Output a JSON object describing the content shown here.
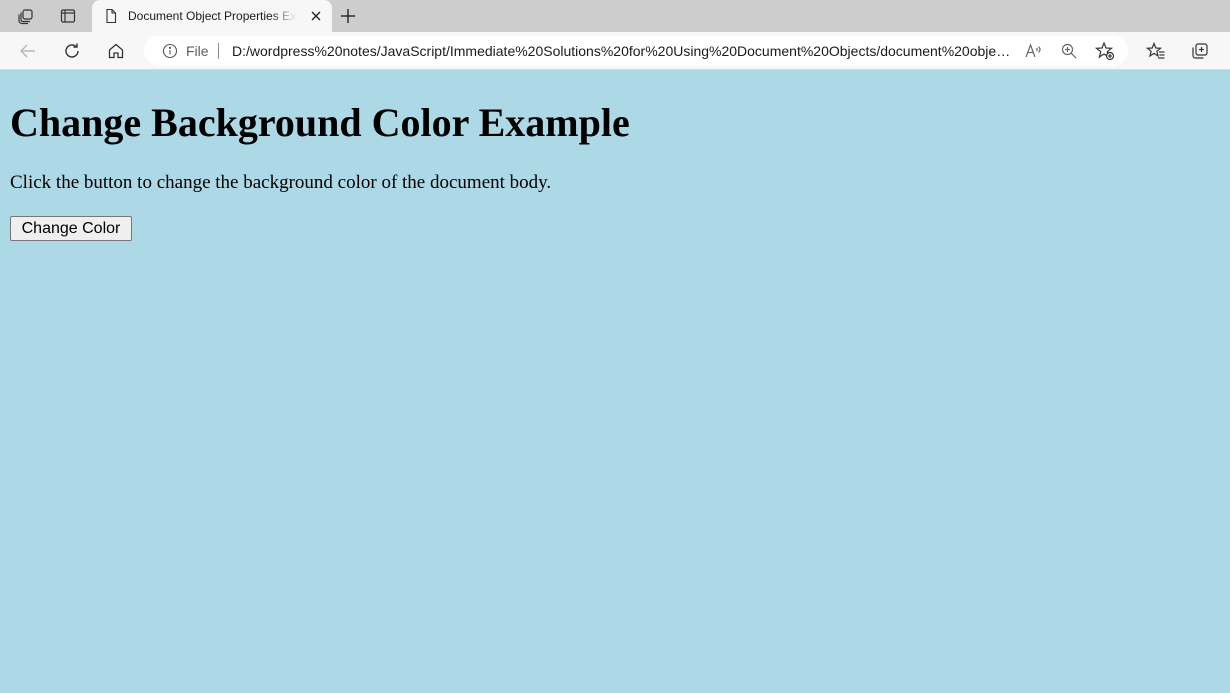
{
  "browser": {
    "tab": {
      "title": "Document Object Properties Example"
    },
    "address_bar": {
      "scheme_label": "File",
      "url": "D:/wordpress%20notes/JavaScript/Immediate%20Solutions%20for%20Using%20Document%20Objects/document%20object..."
    },
    "icons": {
      "workspaces": "workspaces-icon",
      "vertical_tabs": "vertical-tabs-icon",
      "page": "page-icon",
      "close": "close-icon",
      "new_tab": "plus-icon",
      "back": "back-arrow-icon",
      "refresh": "refresh-icon",
      "home": "home-icon",
      "info": "info-icon",
      "read_aloud": "read-aloud-icon",
      "zoom": "zoom-icon",
      "add_favorite": "add-favorite-icon",
      "favorites": "favorites-icon",
      "collections": "collections-icon"
    }
  },
  "page": {
    "background_color": "#add8e6",
    "heading": "Change Background Color Example",
    "description": "Click the button to change the background color of the document body.",
    "button_label": "Change Color"
  }
}
